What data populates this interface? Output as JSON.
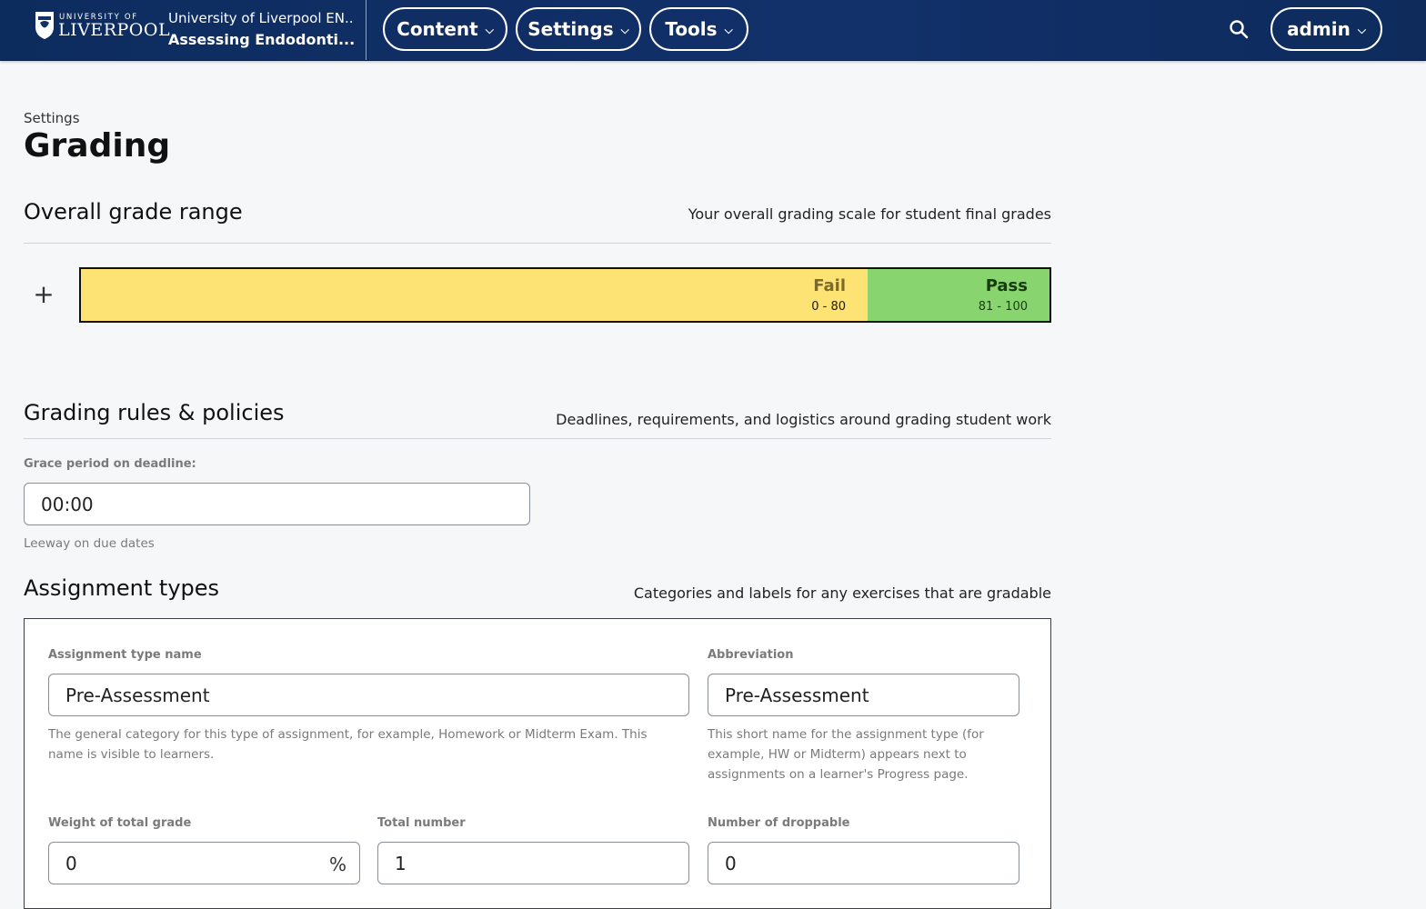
{
  "header": {
    "logo": {
      "top_line": "UNIVERSITY OF",
      "name": "LIVERPOOL"
    },
    "course_org": "University of Liverpool EN...",
    "course_title": "Assessing Endodonti...",
    "nav": [
      {
        "label": "Content"
      },
      {
        "label": "Settings"
      },
      {
        "label": "Tools"
      }
    ],
    "user_menu": "admin"
  },
  "page": {
    "breadcrumb": "Settings",
    "title": "Grading"
  },
  "grade_range": {
    "heading": "Overall grade range",
    "description": "Your overall grading scale for student final grades",
    "segments": [
      {
        "name": "Fail",
        "range": "0 - 80",
        "color": "#fde274"
      },
      {
        "name": "Pass",
        "range": "81 - 100",
        "color": "#88d56f"
      }
    ]
  },
  "rules": {
    "heading": "Grading rules & policies",
    "description": "Deadlines, requirements, and logistics around grading student work",
    "grace_label": "Grace period on deadline:",
    "grace_value": "00:00",
    "grace_help": "Leeway on due dates"
  },
  "assignment_types": {
    "heading": "Assignment types",
    "description": "Categories and labels for any exercises that are gradable",
    "name_label": "Assignment type name",
    "name_value": "Pre-Assessment",
    "name_help": "The general category for this type of assignment, for example, Homework or Midterm Exam. This name is visible to learners.",
    "abbr_label": "Abbreviation",
    "abbr_value": "Pre-Assessment",
    "abbr_help": "This short name for the assignment type (for example, HW or Midterm) appears next to assignments on a learner's Progress page.",
    "weight_label": "Weight of total grade",
    "weight_value": "0",
    "weight_unit": "%",
    "total_label": "Total number",
    "total_value": "1",
    "drop_label": "Number of droppable",
    "drop_value": "0"
  }
}
